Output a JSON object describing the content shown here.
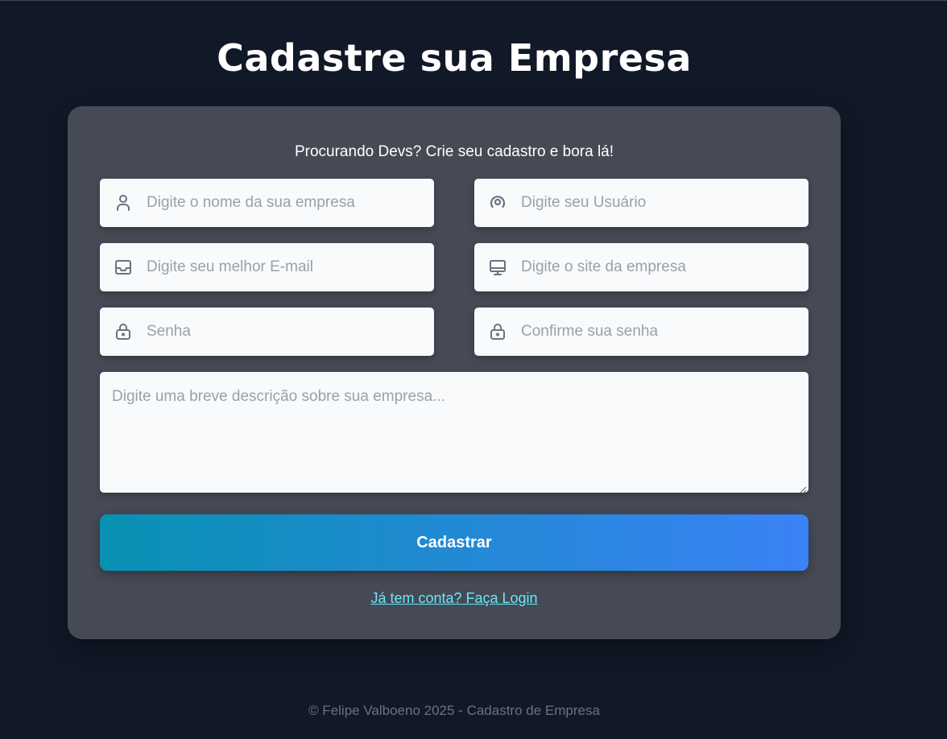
{
  "page": {
    "title": "Cadastre sua Empresa",
    "footer": "© Felipe Valboeno 2025 - Cadastro de Empresa"
  },
  "form": {
    "subtitle": "Procurando Devs? Crie seu cadastro e bora lá!",
    "fields": {
      "company_name": {
        "placeholder": "Digite o nome da sua empresa",
        "value": "",
        "icon": "user-icon"
      },
      "username": {
        "placeholder": "Digite seu Usuário",
        "value": "",
        "icon": "at-sign-icon"
      },
      "email": {
        "placeholder": "Digite seu melhor E-mail",
        "value": "",
        "icon": "inbox-icon"
      },
      "website": {
        "placeholder": "Digite o site da empresa",
        "value": "",
        "icon": "monitor-icon"
      },
      "password": {
        "placeholder": "Senha",
        "value": "",
        "icon": "lock-icon"
      },
      "confirm_password": {
        "placeholder": "Confirme sua senha",
        "value": "",
        "icon": "lock-icon"
      },
      "description": {
        "placeholder": "Digite uma breve descrição sobre sua empresa...",
        "value": ""
      }
    },
    "submit_label": "Cadastrar",
    "login_link": "Já tem conta? Faça Login"
  },
  "colors": {
    "background": "#111827",
    "card": "#454a55",
    "input_bg": "#f8fafc",
    "button_gradient_start": "#0891b2",
    "button_gradient_end": "#3b82f6",
    "link": "#67e8f9",
    "footer_text": "#6b7280"
  }
}
